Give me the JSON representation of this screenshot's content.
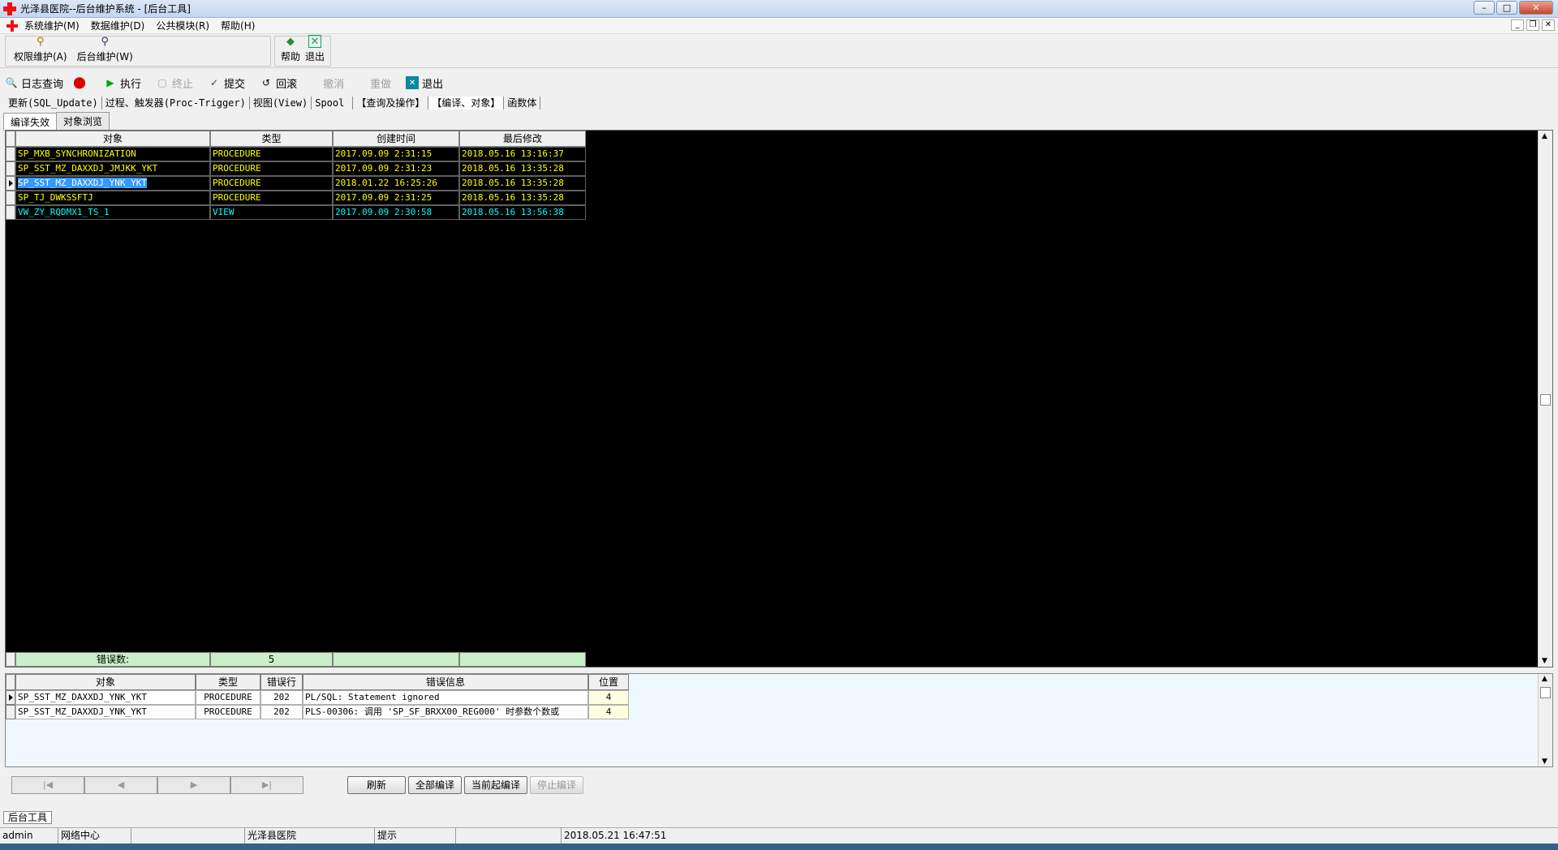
{
  "window": {
    "title": "光泽县医院--后台维护系统 - [后台工具]"
  },
  "menu": [
    "系统维护(M)",
    "数据维护(D)",
    "公共模块(R)",
    "帮助(H)"
  ],
  "toolbar1": {
    "items": [
      {
        "label": "权限维护(A)",
        "icon": "key-icon"
      },
      {
        "label": "后台维护(W)",
        "icon": "magnifier-icon"
      },
      {
        "label": "帮助",
        "icon": "help-book-icon"
      },
      {
        "label": "退出",
        "icon": "exit-icon"
      }
    ]
  },
  "toolbar2": {
    "log_query": "日志查询",
    "execute": "执行",
    "terminate": "终止",
    "commit": "提交",
    "rollback": "回滚",
    "undo": "撤消",
    "redo": "重做",
    "exit": "退出"
  },
  "func_tabs": [
    "更新(SQL_Update)",
    "过程、触发器(Proc-Trigger)",
    "视图(View)",
    "Spool",
    "【查询及操作】",
    "【编译、对象】",
    "函数体"
  ],
  "sub_tabs": [
    "编译失效",
    "对象浏览"
  ],
  "objects_grid": {
    "columns": [
      "对象",
      "类型",
      "创建时间",
      "最后修改"
    ],
    "rows": [
      {
        "object": "SP_MXB_SYNCHRONIZATION",
        "type": "PROCEDURE",
        "created": "2017.09.09 2:31:15",
        "modified": "2018.05.16 13:16:37",
        "color": "#ffff00"
      },
      {
        "object": "SP_SST_MZ_DAXXDJ_JMJKK_YKT",
        "type": "PROCEDURE",
        "created": "2017.09.09 2:31:23",
        "modified": "2018.05.16 13:35:28",
        "color": "#ffff00"
      },
      {
        "object": "SP_SST_MZ_DAXXDJ_YNK_YKT",
        "type": "PROCEDURE",
        "created": "2018.01.22 16:25:26",
        "modified": "2018.05.16 13:35:28",
        "color": "#ffff00"
      },
      {
        "object": "SP_TJ_DWKSSFTJ",
        "type": "PROCEDURE",
        "created": "2017.09.09 2:31:25",
        "modified": "2018.05.16 13:35:28",
        "color": "#ffff00"
      },
      {
        "object": "VW_ZY_RQDMX1_TS_1",
        "type": "VIEW",
        "created": "2017.09.09 2:30:58",
        "modified": "2018.05.16 13:56:38",
        "color": "#00ffff"
      }
    ],
    "selected_row": 2,
    "footer_label": "错误数:",
    "footer_count": "5"
  },
  "errors_grid": {
    "columns": [
      "对象",
      "类型",
      "错误行",
      "错误信息",
      "位置"
    ],
    "rows": [
      {
        "object": "SP_SST_MZ_DAXXDJ_YNK_YKT",
        "type": "PROCEDURE",
        "line": "202",
        "message": "PL/SQL: Statement ignored",
        "pos": "4"
      },
      {
        "object": "SP_SST_MZ_DAXXDJ_YNK_YKT",
        "type": "PROCEDURE",
        "line": "202",
        "message": "PLS-00306: 调用 'SP_SF_BRXX00_REG000' 时参数个数或",
        "pos": "4"
      }
    ]
  },
  "buttons": {
    "refresh": "刷新",
    "compile_all": "全部编译",
    "compile_from_current": "当前起编译",
    "stop_compile": "停止编译"
  },
  "mdi_tab": "后台工具",
  "status": [
    "admin",
    "网络中心",
    "",
    "光泽县医院",
    "提示",
    "",
    "2018.05.21 16:47:51"
  ]
}
